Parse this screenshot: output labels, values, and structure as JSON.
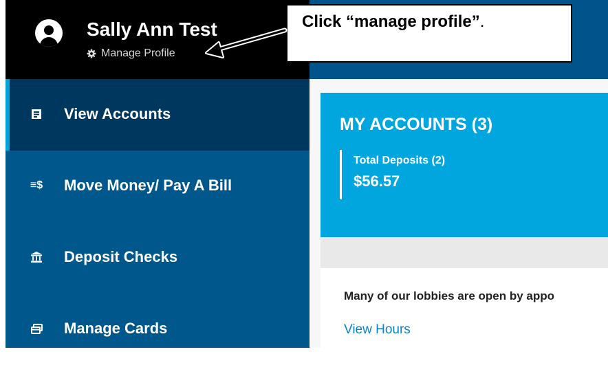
{
  "header": {
    "user_name": "Sally Ann Test",
    "manage_profile_label": "Manage Profile"
  },
  "sidebar": {
    "items": [
      {
        "label": "View Accounts",
        "icon": "accounts-icon",
        "active": true
      },
      {
        "label": "Move Money/ Pay A Bill",
        "icon": "transfer-icon",
        "active": false
      },
      {
        "label": "Deposit Checks",
        "icon": "bank-icon",
        "active": false
      },
      {
        "label": "Manage Cards",
        "icon": "card-icon",
        "active": false
      }
    ],
    "transfer_glyph": "≡$"
  },
  "accounts": {
    "title": "MY ACCOUNTS (3)",
    "deposits_label": "Total Deposits (2)",
    "deposits_amount": "$56.57"
  },
  "notice": {
    "text": "Many of our lobbies are open by appo",
    "link_label": "View Hours"
  },
  "callout": {
    "prefix": "Click ",
    "highlight": "“manage profile”",
    "suffix": "."
  },
  "colors": {
    "header_bg": "#000000",
    "sidebar_bg": "#00578c",
    "sidebar_active_bg": "#00375e",
    "active_indicator": "#00a2d9",
    "top_bar_bg": "#00548c",
    "accounts_card_bg": "#00a6dd",
    "link": "#0a83c5"
  }
}
